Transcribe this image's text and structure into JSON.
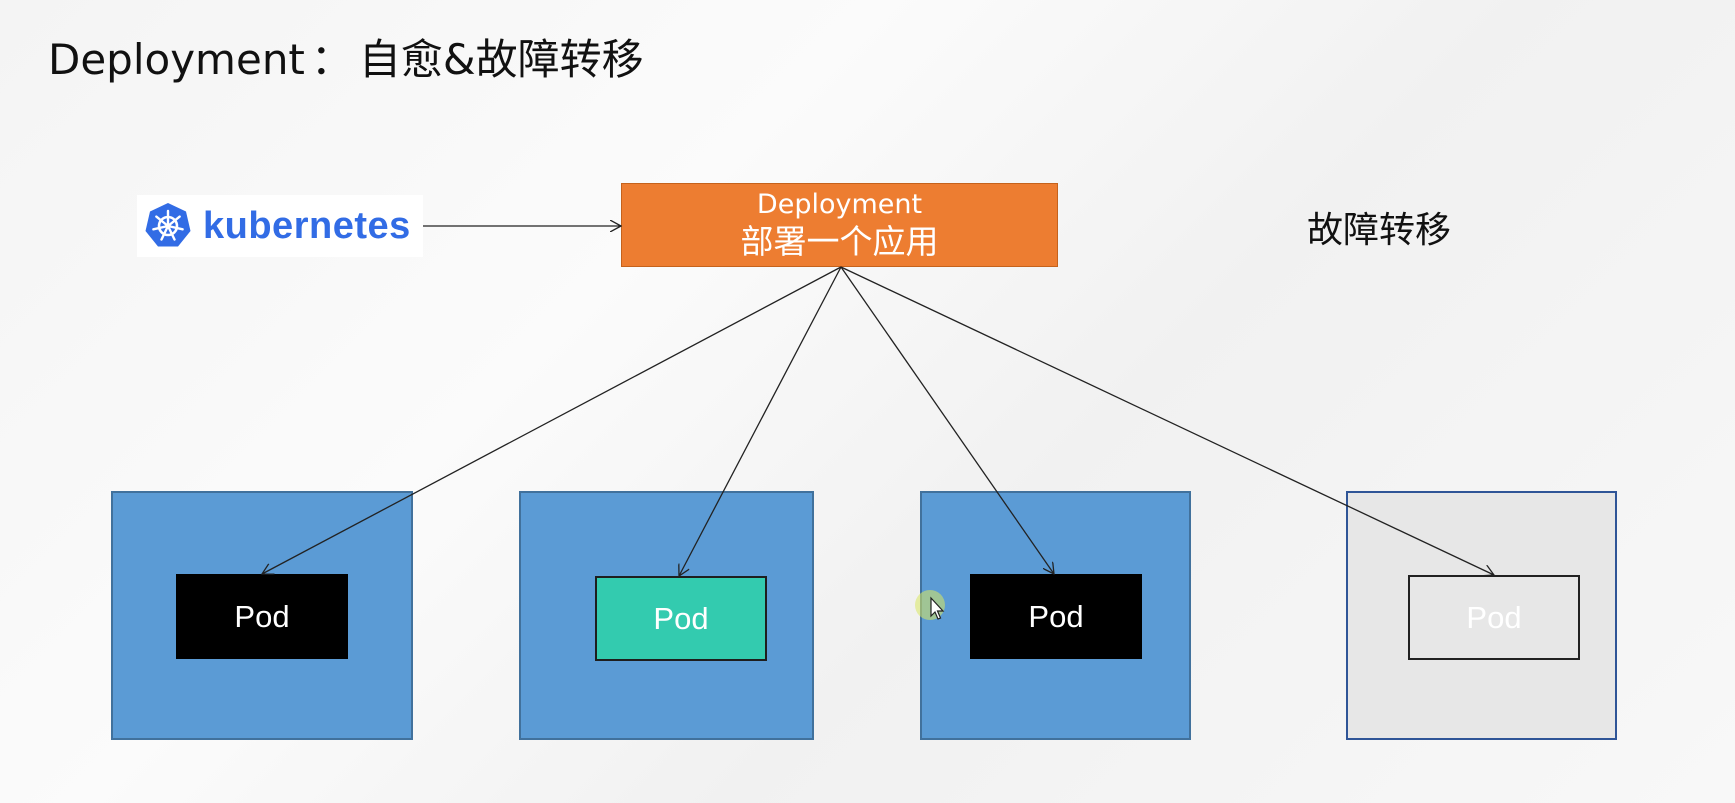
{
  "title": {
    "main": "Deployment",
    "separator": "：",
    "sub": "自愈&故障转移"
  },
  "logo": {
    "text": "kubernetes",
    "icon": "kubernetes-helm-icon",
    "brand_color": "#326ce5"
  },
  "deployment": {
    "line1": "Deployment",
    "line2": "部署一个应用",
    "color": "#ed7d31"
  },
  "failover_label": "故障转移",
  "nodes": [
    {
      "pod_label": "Pod",
      "state": "running",
      "color": "#000000"
    },
    {
      "pod_label": "Pod",
      "state": "self-healed",
      "color": "#33cbaf"
    },
    {
      "pod_label": "Pod",
      "state": "running",
      "color": "#000000"
    },
    {
      "pod_label": "Pod",
      "state": "failed",
      "color": "#e7e7e7"
    }
  ],
  "colors": {
    "node": "#5b9bd5",
    "failed_node": "#e7e7e7"
  },
  "cursor": {
    "icon": "mouse-pointer-icon"
  }
}
